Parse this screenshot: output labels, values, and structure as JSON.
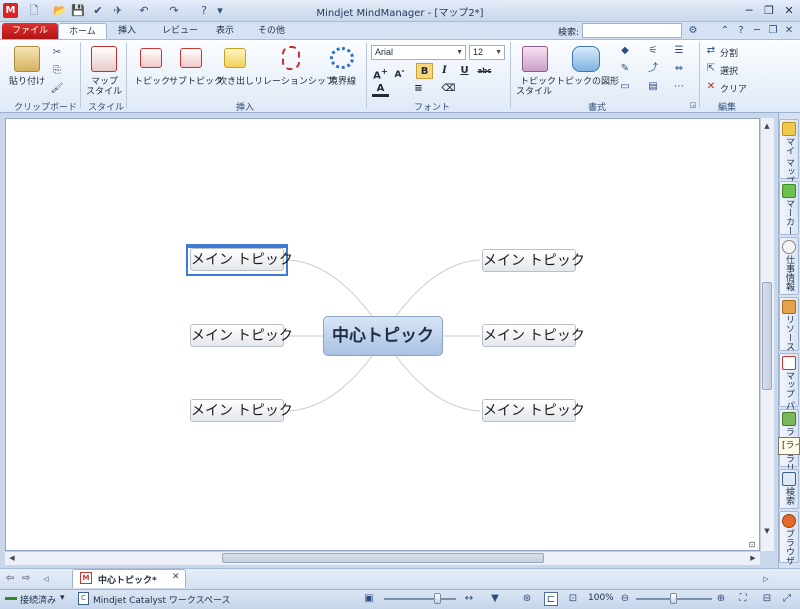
{
  "window": {
    "title": "Mindjet MindManager - [マップ2*]"
  },
  "tabs": [
    {
      "label": "ファイル"
    },
    {
      "label": "ホーム"
    },
    {
      "label": "挿入"
    },
    {
      "label": "レビュー"
    },
    {
      "label": "表示"
    },
    {
      "label": "その他"
    }
  ],
  "search": {
    "label": "検索:",
    "value": ""
  },
  "ribbon": {
    "clipboard": {
      "paste": "貼り付け",
      "group": "クリップボード"
    },
    "style": {
      "map_style": "マップ",
      "map_style_2": "スタイル",
      "group": "スタイル"
    },
    "insert": {
      "topic": "トピック",
      "subtopic": "サブトピック",
      "callout": "吹き出し",
      "relationship": "リレーションシップ",
      "boundary": "境界線",
      "group": "挿入"
    },
    "font": {
      "family": "Arial",
      "size": "12",
      "group": "フォント"
    },
    "format": {
      "topic_style": "トピック",
      "topic_style_2": "スタイル",
      "topic_shape": "トピックの図形",
      "group": "書式"
    },
    "editing": {
      "split": "分割",
      "select": "選択",
      "clear": "クリア",
      "group": "編集"
    }
  },
  "mindmap": {
    "central": "中心トピック",
    "topics": [
      "メイン トピック",
      "メイン トピック",
      "メイン トピック",
      "メイン トピック",
      "メイン トピック",
      "メイン トピック"
    ]
  },
  "side_panel": {
    "tabs": [
      "マイ マップ",
      "マーカー",
      "仕事情報",
      "リソース",
      "マップ パーツ",
      "ライブラリ",
      "検索",
      "ブラウザ"
    ],
    "tooltip": "[ライブラリ]"
  },
  "doc_tab": {
    "label": "中心トピック*"
  },
  "status": {
    "connection": "接続済み",
    "workspace": "Mindjet Catalyst ワークスペース",
    "zoom": "100%",
    "zoom_fraction": 0.5
  },
  "colors": {
    "accent": "#3d7bd6",
    "file_tab": "#c81e1e",
    "central_fill": "#b8cce9"
  }
}
